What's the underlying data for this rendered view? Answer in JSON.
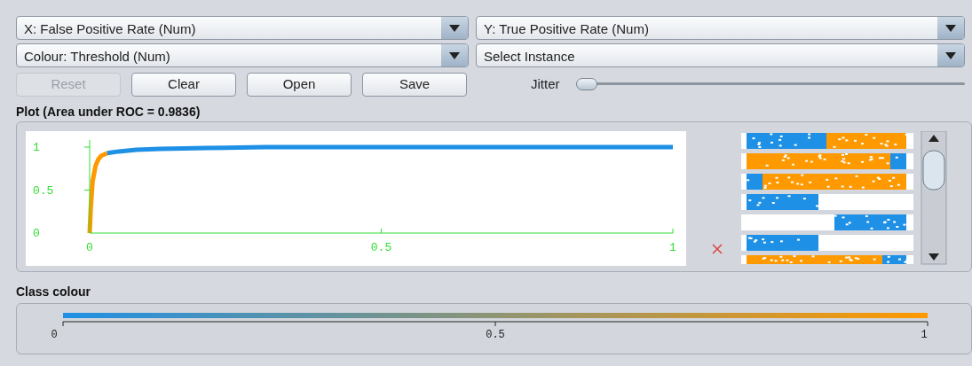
{
  "selectors": [
    {
      "label": "X: False Positive Rate (Num)"
    },
    {
      "label": "Y: True Positive Rate (Num)"
    },
    {
      "label": "Colour: Threshold (Num)"
    },
    {
      "label": "Select Instance"
    }
  ],
  "buttons": [
    {
      "label": "Reset",
      "disabled": true
    },
    {
      "label": "Clear",
      "disabled": false
    },
    {
      "label": "Open",
      "disabled": false
    },
    {
      "label": "Save",
      "disabled": false
    }
  ],
  "jitter": {
    "label": "Jitter",
    "level": 0
  },
  "plot": {
    "title": "Plot (Area under ROC = 0.9836)",
    "chart_data": {
      "type": "line",
      "x": [
        0,
        0.002,
        0.005,
        0.01,
        0.015,
        0.02,
        0.03,
        0.05,
        0.08,
        0.12,
        0.2,
        0.3,
        0.45,
        0.6,
        0.8,
        1
      ],
      "series": [
        {
          "color": "#ff9900",
          "values": [
            0,
            0.3,
            0.6,
            0.78,
            0.86,
            0.9,
            0.93,
            null,
            null,
            null,
            null,
            null,
            null,
            null,
            null,
            null
          ]
        },
        {
          "color": "#1e90e6",
          "values": [
            null,
            null,
            null,
            null,
            null,
            null,
            0.93,
            0.95,
            0.97,
            0.98,
            0.99,
            1,
            1,
            1,
            1,
            1
          ]
        }
      ],
      "xlim": [
        0,
        1
      ],
      "ylim": [
        0,
        1
      ],
      "xticks": [
        0,
        0.5,
        1
      ],
      "yticks": [
        0,
        0.5,
        1
      ]
    }
  },
  "class_colour": {
    "title": "Class colour",
    "ticks": [
      "0",
      "0.5",
      "1"
    ]
  }
}
